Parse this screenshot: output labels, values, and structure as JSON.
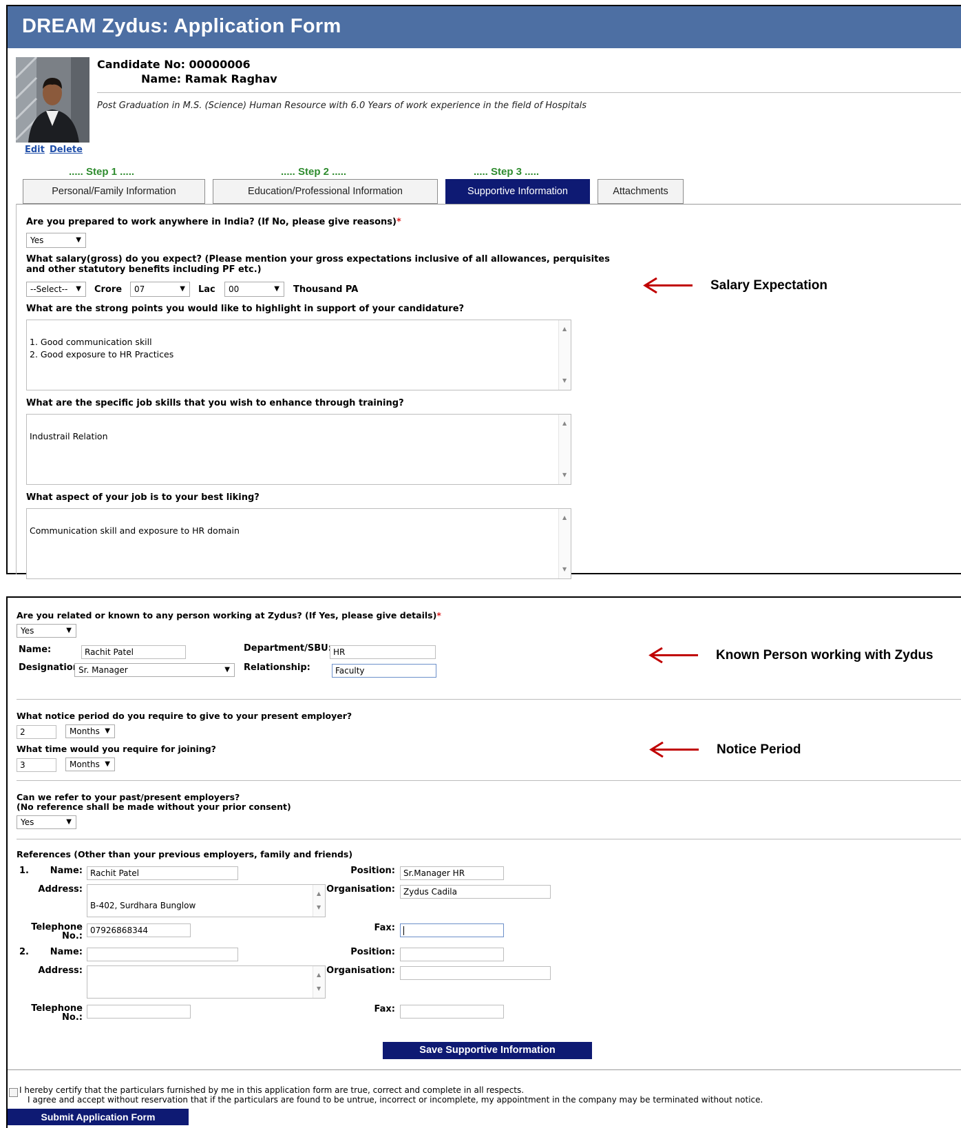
{
  "app": {
    "title": "DREAM Zydus: Application Form"
  },
  "candidate": {
    "number_line": "Candidate No: 00000006",
    "name_line": "Name: Ramak Raghav",
    "summary": "Post Graduation in M.S. (Science) Human Resource with 6.0 Years of work experience in the field of Hospitals",
    "edit_label": "Edit",
    "delete_label": "Delete"
  },
  "steps": [
    "..... Step 1 .....",
    "..... Step 2 .....",
    "..... Step 3 ....."
  ],
  "tabs": [
    {
      "label": "Personal/Family Information",
      "active": false
    },
    {
      "label": "Education/Professional Information",
      "active": false
    },
    {
      "label": "Supportive Information",
      "active": true
    },
    {
      "label": "Attachments",
      "active": false
    }
  ],
  "form": {
    "q_anywhere": "Are you prepared to work anywhere in India? (If No, please give reasons)",
    "anywhere_value": "Yes",
    "q_salary_line1": "What salary(gross) do you expect? (Please mention your gross expectations inclusive of all allowances, perquisites",
    "q_salary_line2": "and other statutory benefits including PF etc.)",
    "salary": {
      "select_value": "--Select--",
      "crore_label": "Crore",
      "crore_value": "07",
      "lac_label": "Lac",
      "lac_value": "00",
      "thousand_label": "Thousand PA"
    },
    "q_strong": "What are the strong points you would like to highlight in support of your candidature?",
    "strong_value": "1. Good communication skill\n2. Good exposure to HR Practices",
    "q_skills": "What are the specific job skills that you wish to enhance through training?",
    "skills_value": "Industrail Relation",
    "q_liking": "What aspect of your job is to your best liking?",
    "liking_value": "Communication skill and exposure to HR domain",
    "q_related": "Are you related or known to any person working at Zydus? (If Yes, please give details)",
    "related_value": "Yes",
    "known": {
      "name_label": "Name:",
      "name_value": "Rachit Patel",
      "dept_label": "Department/SBU:",
      "dept_value": "HR",
      "designation_label": "Designation:",
      "designation_value": "Sr. Manager",
      "relationship_label": "Relationship:",
      "relationship_value": "Faculty"
    },
    "q_notice": "What notice period do you require to give to your present employer?",
    "notice_value": "2",
    "notice_unit": "Months",
    "q_joining": "What time would you require for joining?",
    "joining_value": "3",
    "joining_unit": "Months",
    "q_refer_line1": "Can we refer to your past/present employers?",
    "q_refer_line2": "(No reference shall be made without your prior consent)",
    "refer_value": "Yes",
    "references_title": "References (Other than your previous employers, family and friends)",
    "ref_labels": {
      "name": "Name:",
      "address": "Address:",
      "telephone_1": "Telephone",
      "telephone_2": "No.:",
      "position": "Position:",
      "organisation": "Organisation:",
      "fax": "Fax:"
    },
    "refs": [
      {
        "num": "1.",
        "name": "Rachit Patel",
        "address": "B-402, Surdhara Bunglow",
        "telephone": "07926868344",
        "position": "Sr.Manager HR",
        "organisation": "Zydus Cadila",
        "fax": ""
      },
      {
        "num": "2.",
        "name": "",
        "address": "",
        "telephone": "",
        "position": "",
        "organisation": "",
        "fax": ""
      }
    ],
    "save_button": "Save Supportive Information",
    "certify_line1": "I hereby certify that the particulars furnished by me in this application form are true, correct and complete in all respects.",
    "certify_line2": "I agree and accept without reservation that if the particulars are found to be untrue, incorrect or incomplete, my appointment in the company may be terminated without notice.",
    "submit_button": "Submit Application Form"
  },
  "annotations": {
    "salary": "Salary Expectation",
    "known": "Known Person working with Zydus",
    "notice": "Notice Period",
    "arrow_color": "#c00000"
  },
  "colors": {
    "header": "#4d6fa3",
    "navy": "#0e1a73",
    "step_green": "#2e8b2e",
    "link": "#1f4ea8"
  }
}
